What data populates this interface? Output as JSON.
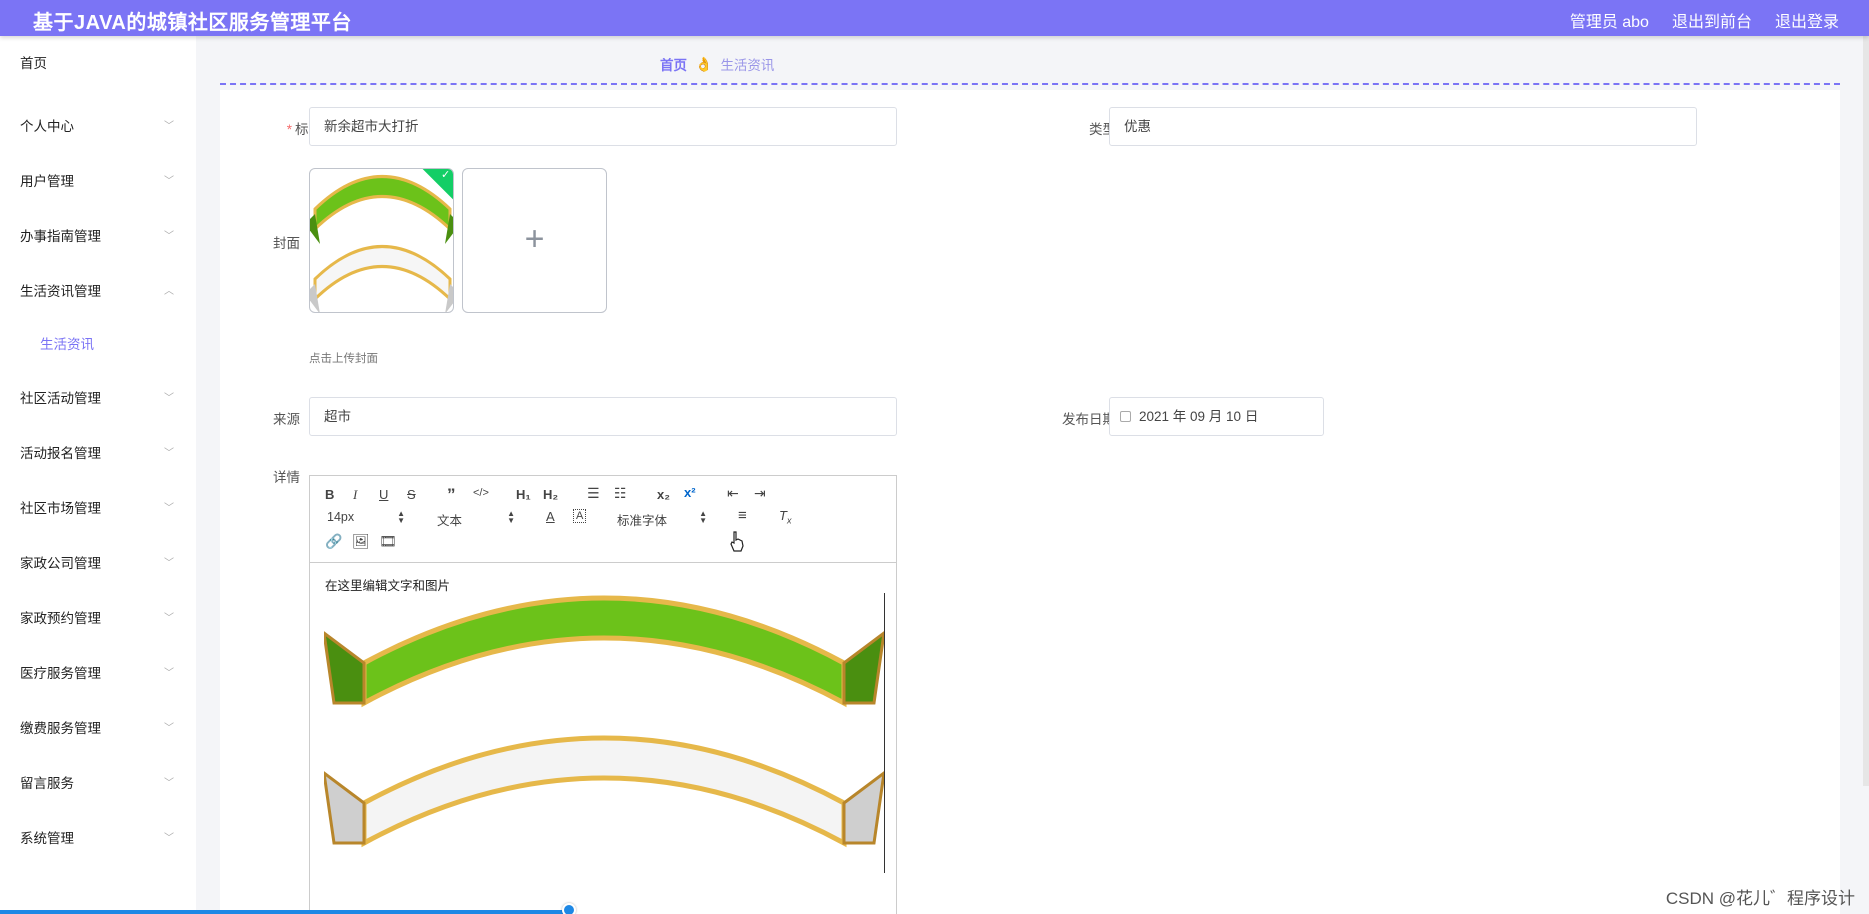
{
  "header": {
    "app_title": "基于JAVA的城镇社区服务管理平台",
    "admin_label": "管理员 abo",
    "back_frontend": "退出到前台",
    "logout": "退出登录"
  },
  "sidebar": {
    "home": "首页",
    "items": [
      "个人中心",
      "用户管理",
      "办事指南管理",
      "生活资讯管理",
      "社区活动管理",
      "活动报名管理",
      "社区市场管理",
      "家政公司管理",
      "家政预约管理",
      "医疗服务管理",
      "缴费服务管理",
      "留言服务",
      "系统管理"
    ],
    "sub_item": "生活资讯"
  },
  "breadcrumb": {
    "home": "首页",
    "current": "生活资讯"
  },
  "form": {
    "title_label": "标题",
    "title_value": "新余超市大打折",
    "type_label": "类型",
    "type_value": "优惠",
    "cover_label": "封面",
    "cover_tip": "点击上传封面",
    "source_label": "来源",
    "source_value": "超市",
    "date_label": "发布日期",
    "date_value": "2021 年 09 月 10 日",
    "detail_label": "详情"
  },
  "editor": {
    "font_size": "14px",
    "text_style": "文本",
    "font_family": "标准字体",
    "body_text": "在这里编辑文字和图片"
  },
  "watermark": "CSDN @花儿゛程序设计",
  "colors": {
    "accent": "#7b74f5",
    "ribbon_green": "#6cc21a",
    "ribbon_gold": "#e6b84a",
    "success": "#13ce66"
  }
}
